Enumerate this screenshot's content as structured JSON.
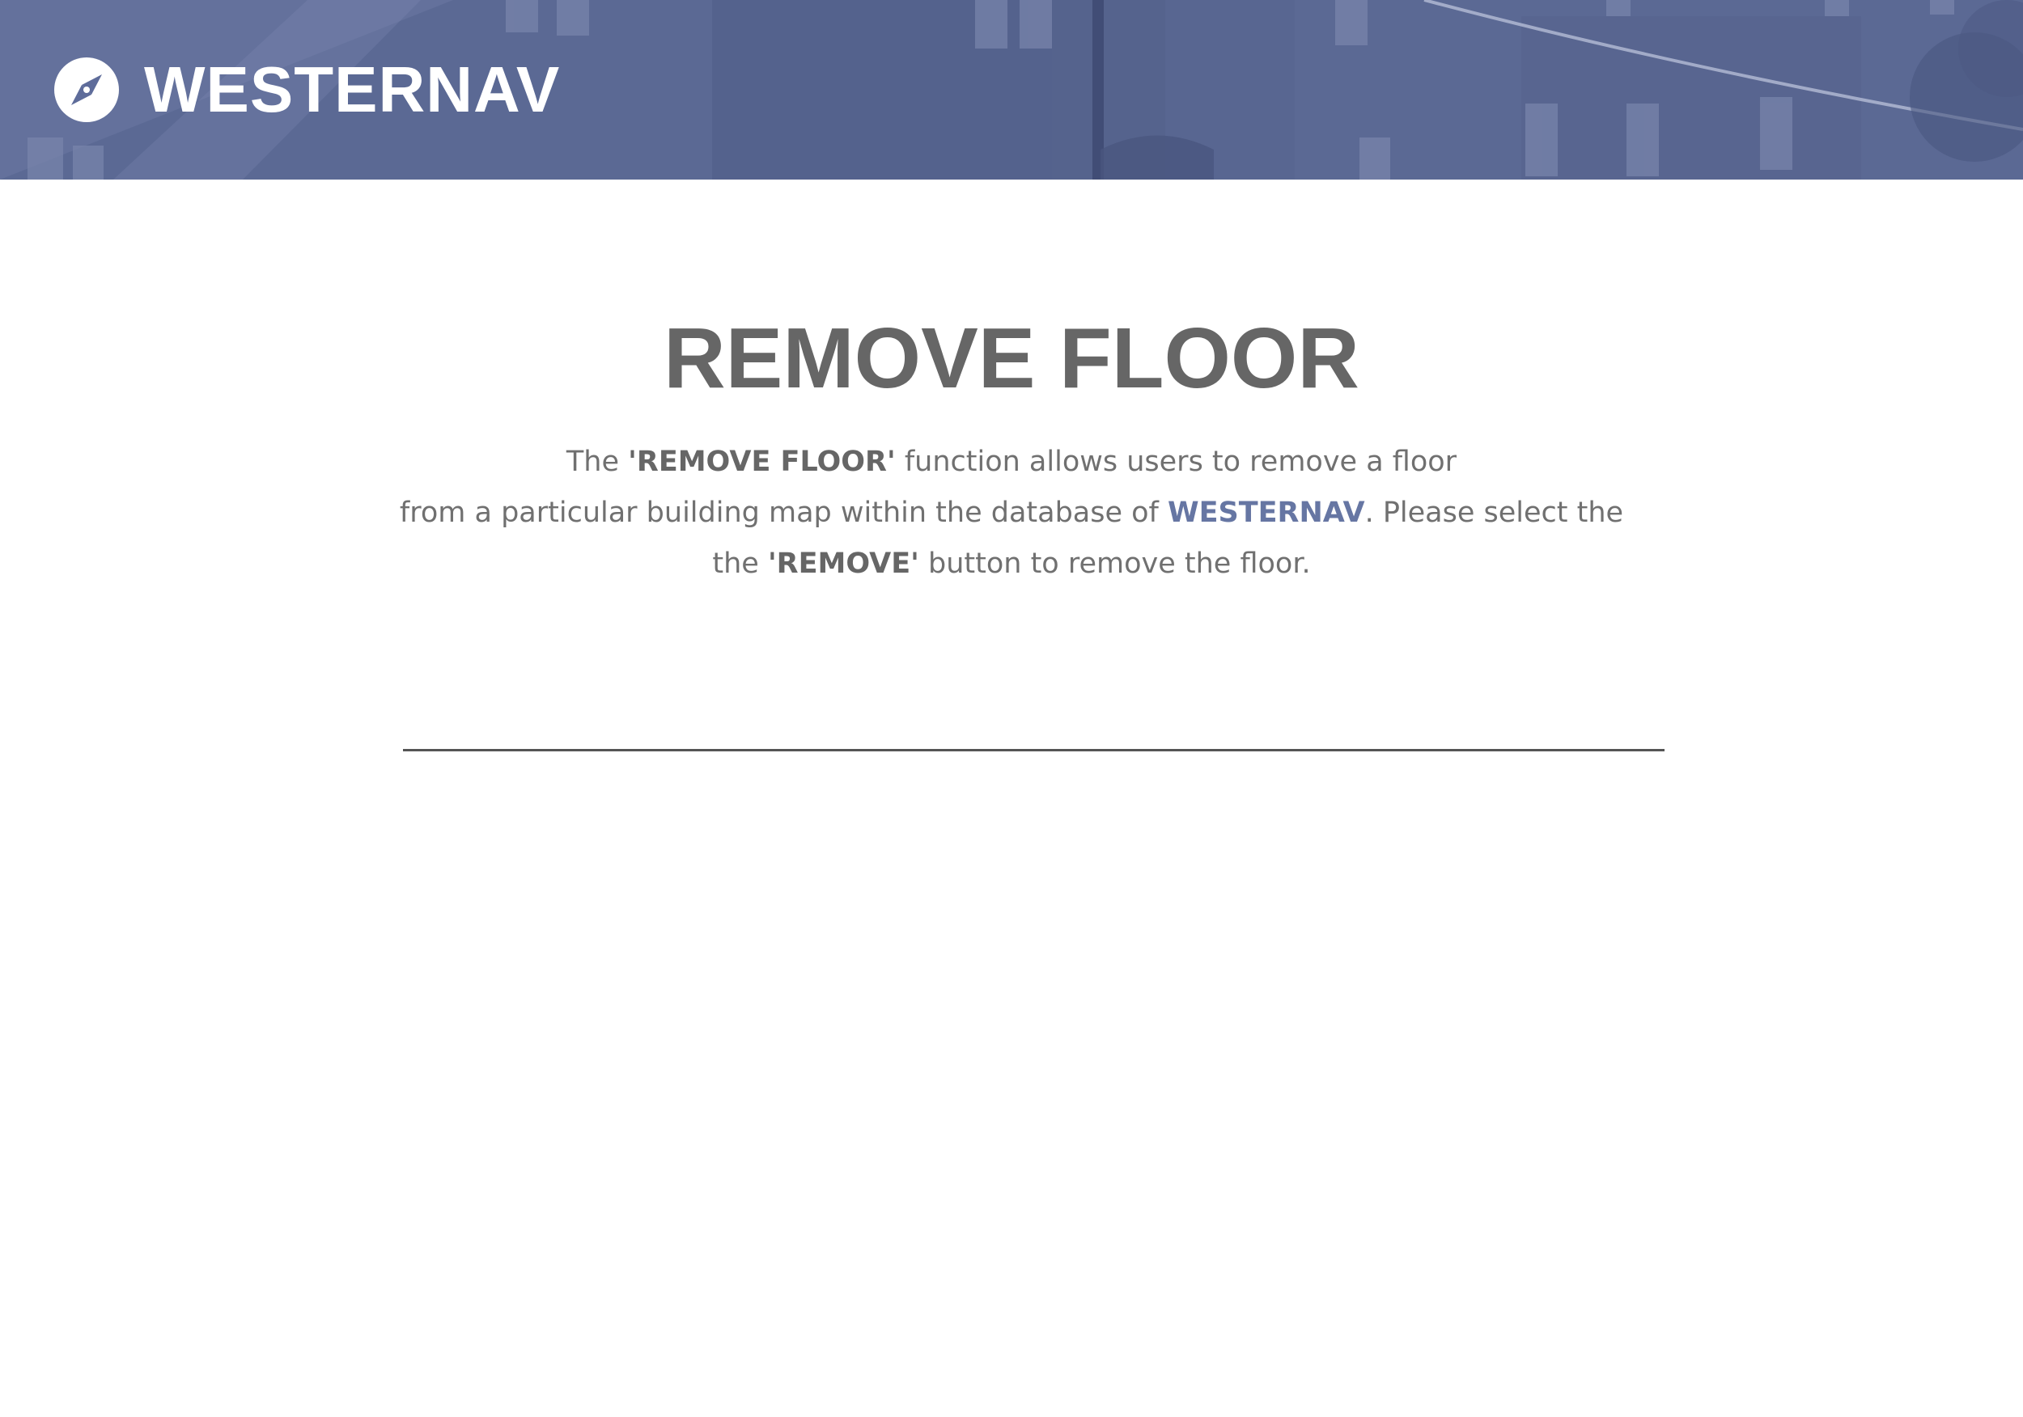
{
  "header": {
    "brand_name": "WESTERNAV",
    "logo_icon": "compass-icon",
    "banner_color": "#5e6c9a"
  },
  "main": {
    "title": "REMOVE FLOOR",
    "description": {
      "line1": {
        "pre": "The ",
        "strong": "'REMOVE FLOOR'",
        "post": " function allows users to remove a floor"
      },
      "line2": {
        "pre": "from a particular building map within the database of ",
        "strong": "WESTERNAV",
        "post": ". Please select the"
      },
      "line3": {
        "pre": "the ",
        "strong": "'REMOVE'",
        "post": " button to remove the floor."
      }
    }
  },
  "colors": {
    "text_gray": "#666666",
    "accent_blue": "#6676a3",
    "divider": "#555555"
  }
}
